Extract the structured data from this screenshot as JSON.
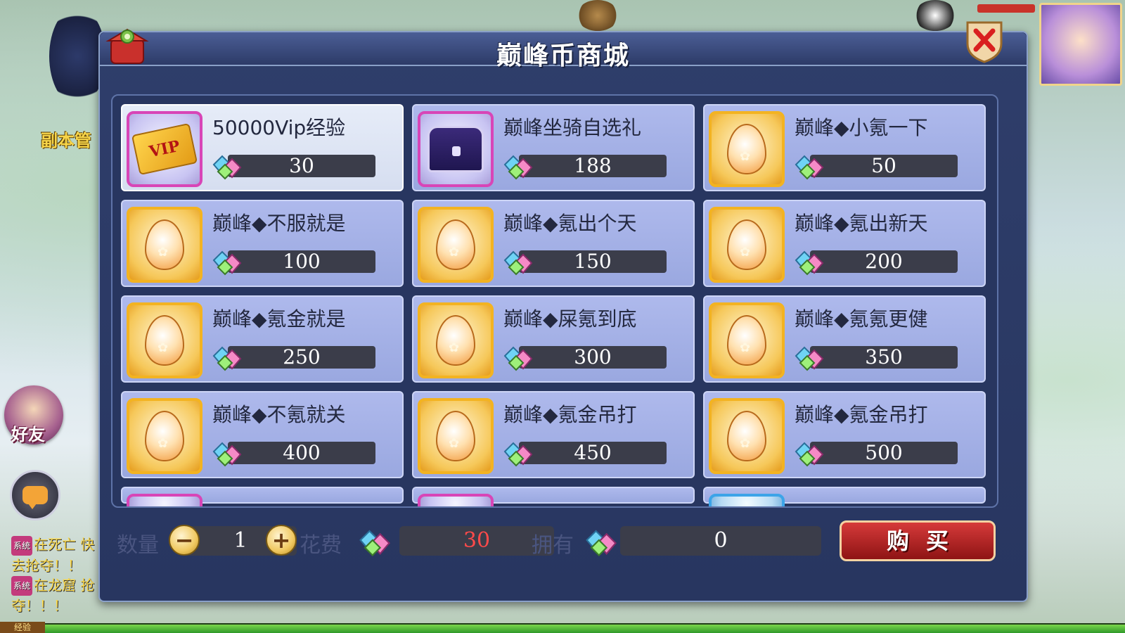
{
  "background": {
    "left_label": "副本管",
    "friend_label": "好友",
    "system_messages": [
      {
        "tag": "系统",
        "text": "在死亡 快去抢夺！！"
      },
      {
        "tag": "系统",
        "text": "在龙窟 抢夺！！！"
      }
    ],
    "exp_label": "经验"
  },
  "dialog": {
    "title": "巅峰币商城",
    "close_icon": "close-x-icon",
    "items": [
      {
        "name": "50000Vip经验",
        "price": "30",
        "icon": "vip-card",
        "frame": "purple",
        "selected": true
      },
      {
        "name": "巅峰坐骑自选礼",
        "price": "188",
        "icon": "treasure-chest",
        "frame": "purple",
        "selected": false
      },
      {
        "name": "巅峰◆小氪一下",
        "price": "50",
        "icon": "egg",
        "frame": "gold",
        "selected": false
      },
      {
        "name": "巅峰◆不服就是",
        "price": "100",
        "icon": "egg",
        "frame": "gold",
        "selected": false
      },
      {
        "name": "巅峰◆氪出个天",
        "price": "150",
        "icon": "egg",
        "frame": "gold",
        "selected": false
      },
      {
        "name": "巅峰◆氪出新天",
        "price": "200",
        "icon": "egg",
        "frame": "gold",
        "selected": false
      },
      {
        "name": "巅峰◆氪金就是",
        "price": "250",
        "icon": "egg",
        "frame": "gold",
        "selected": false
      },
      {
        "name": "巅峰◆屎氪到底",
        "price": "300",
        "icon": "egg",
        "frame": "gold",
        "selected": false
      },
      {
        "name": "巅峰◆氪氪更健",
        "price": "350",
        "icon": "egg",
        "frame": "gold",
        "selected": false
      },
      {
        "name": "巅峰◆不氪就关",
        "price": "400",
        "icon": "egg",
        "frame": "gold",
        "selected": false
      },
      {
        "name": "巅峰◆氪金吊打",
        "price": "450",
        "icon": "egg",
        "frame": "gold",
        "selected": false
      },
      {
        "name": "巅峰◆氪金吊打",
        "price": "500",
        "icon": "egg",
        "frame": "gold",
        "selected": false
      }
    ],
    "partial_row_frames": [
      "purple",
      "purple",
      "blue"
    ],
    "quantity_label": "数量",
    "quantity": "1",
    "cost_label": "花费",
    "cost": "30",
    "own_label": "拥有",
    "own": "0",
    "buy_label": "购买"
  },
  "colors": {
    "panel_bg": "#283660",
    "card_bg": "#aeb9ec",
    "selected_card_bg": "#e6ecf8",
    "buy_button": "#c62828",
    "cost_text": "#ff4a4a"
  }
}
